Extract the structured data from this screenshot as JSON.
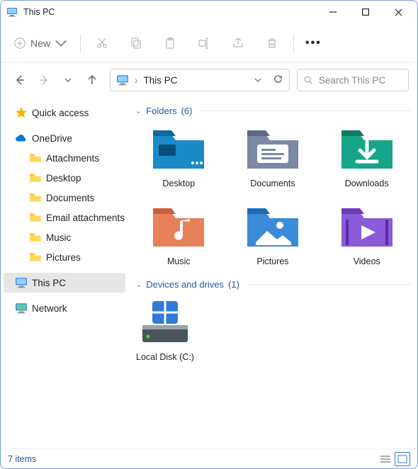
{
  "window": {
    "title": "This PC"
  },
  "toolbar": {
    "new_label": "New"
  },
  "address": {
    "path": "This PC"
  },
  "search": {
    "placeholder": "Search This PC"
  },
  "sidebar": {
    "quick_access": "Quick access",
    "onedrive": "OneDrive",
    "onedrive_children": [
      {
        "label": "Attachments"
      },
      {
        "label": "Desktop"
      },
      {
        "label": "Documents"
      },
      {
        "label": "Email attachments"
      },
      {
        "label": "Music"
      },
      {
        "label": "Pictures"
      }
    ],
    "this_pc": "This PC",
    "network": "Network"
  },
  "groups": {
    "folders": {
      "label": "Folders",
      "count": "(6)"
    },
    "drives": {
      "label": "Devices and drives",
      "count": "(1)"
    }
  },
  "folders": [
    {
      "label": "Desktop"
    },
    {
      "label": "Documents"
    },
    {
      "label": "Downloads"
    },
    {
      "label": "Music"
    },
    {
      "label": "Pictures"
    },
    {
      "label": "Videos"
    }
  ],
  "drives": [
    {
      "label": "Local Disk (C:)"
    }
  ],
  "status": {
    "item_count": "7 items"
  }
}
